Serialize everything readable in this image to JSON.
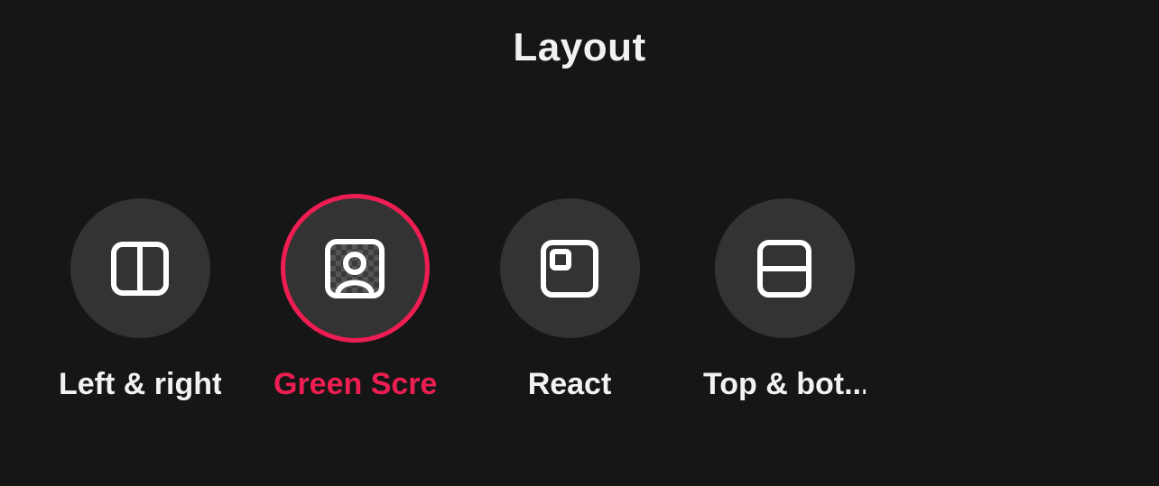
{
  "header": {
    "title": "Layout"
  },
  "options": [
    {
      "id": "left-right",
      "label": "Left & right",
      "icon": "split-vertical-icon",
      "selected": false
    },
    {
      "id": "green-screen",
      "label": "Green Scre",
      "icon": "person-bg-icon",
      "selected": true
    },
    {
      "id": "react",
      "label": "React",
      "icon": "pip-icon",
      "selected": false
    },
    {
      "id": "top-bottom",
      "label": "Top & bot...",
      "icon": "split-horizontal-icon",
      "selected": false
    }
  ],
  "colors": {
    "accent": "#EE1D52",
    "text": "#f2f2f2",
    "circle": "#333333",
    "bg": "#161616"
  }
}
